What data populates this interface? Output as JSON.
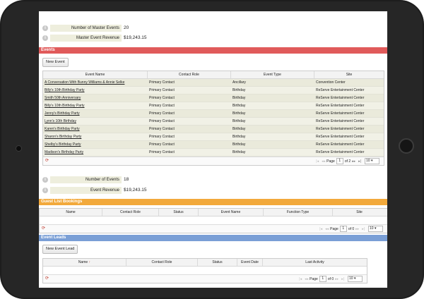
{
  "stats_top": {
    "label1": "Number of Master Events",
    "value1": "20",
    "label2": "Master Event Revenue",
    "value2": "$19,243.15"
  },
  "events": {
    "title": "Events",
    "new_button": "New Event",
    "columns": [
      "Event Name",
      "Contact Role",
      "Event Type",
      "Site"
    ],
    "rows": [
      [
        "A Conversation With Bunny Williams & Annie Selke",
        "Primary Contact",
        "Ancillary",
        "Convention Center"
      ],
      [
        "Billy's 10th Birthday Party",
        "Primary Contact",
        "Birthday",
        "ReServe Entertainment Center"
      ],
      [
        "Smith 50th Anniversary",
        "Primary Contact",
        "Birthday",
        "ReServe Entertainment Center"
      ],
      [
        "Billy's 10th Birthday Party",
        "Primary Contact",
        "Birthday",
        "ReServe Entertainment Center"
      ],
      [
        "Jenny's Birthday Party",
        "Primary Contact",
        "Birthday",
        "ReServe Entertainment Center"
      ],
      [
        "Lynn's 10th Birthday",
        "Primary Contact",
        "Birthday",
        "ReServe Entertainment Center"
      ],
      [
        "Karen's Birthday Party",
        "Primary Contact",
        "Birthday",
        "ReServe Entertainment Center"
      ],
      [
        "Sharon's Birthday Party",
        "Primary Contact",
        "Birthday",
        "ReServe Entertainment Center"
      ],
      [
        "Shelby's Birthday Party",
        "Primary Contact",
        "Birthday",
        "ReServe Entertainment Center"
      ],
      [
        "Madison's Birthday Party",
        "Primary Contact",
        "Birthday",
        "ReServe Entertainment Center"
      ]
    ],
    "pager": {
      "page_label": "Page",
      "page": "1",
      "of_label": "of 2",
      "page_size": "10"
    }
  },
  "stats_mid": {
    "label1": "Number of Events",
    "value1": "18",
    "label2": "Event Revenue",
    "value2": "$19,243.15"
  },
  "guest": {
    "title": "Guest List Bookings",
    "columns": [
      "Name",
      "Contact Role",
      "Status",
      "Event Name",
      "Function Type",
      "Site"
    ],
    "pager": {
      "page_label": "Page",
      "page": "1",
      "of_label": "of 0",
      "page_size": "10"
    }
  },
  "leads": {
    "title": "Event Leads",
    "new_button": "New Event Lead",
    "columns": [
      "Name",
      "Contact Role",
      "Status",
      "Event Date",
      "Last Activity"
    ],
    "sort_glyph": "↑",
    "pager": {
      "page_label": "Page",
      "page": "1",
      "of_label": "of 0",
      "page_size": "10"
    }
  },
  "icons": {
    "info": "info-icon",
    "refresh": "refresh-icon"
  },
  "colors": {
    "events_bar": "#e05a5a",
    "guest_bar": "#f2a93b",
    "leads_bar": "#7a9fd6"
  }
}
